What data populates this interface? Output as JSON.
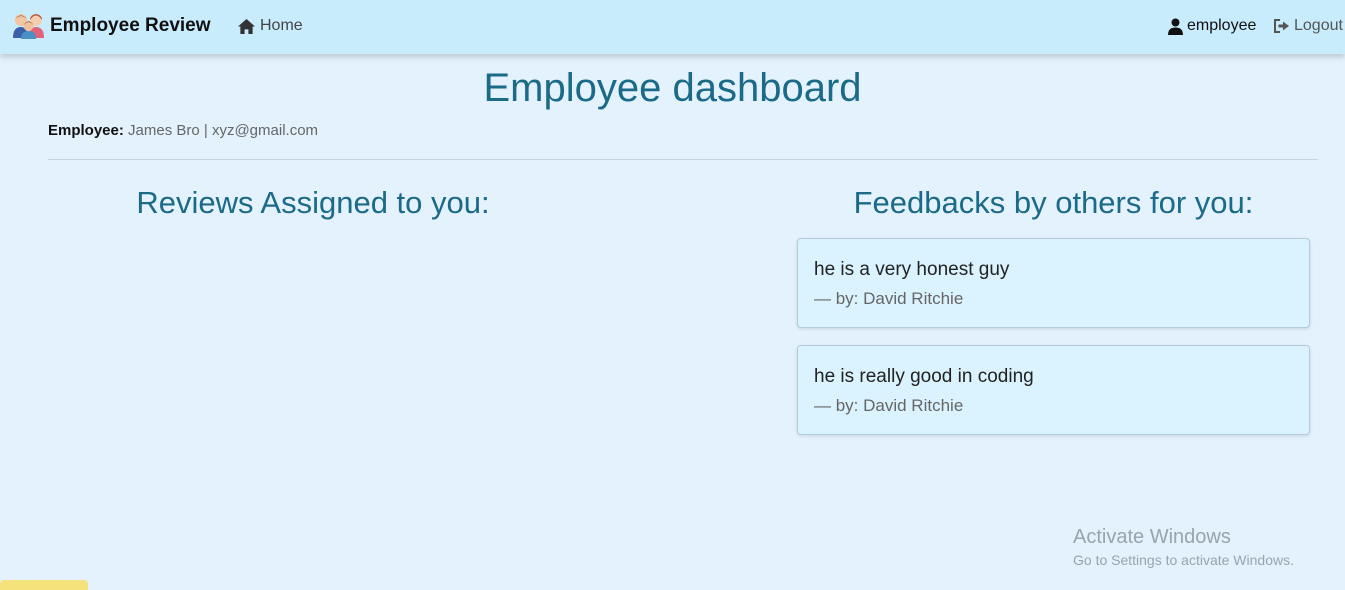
{
  "navbar": {
    "brand": "Employee Review",
    "brand_icon": "team-avatars-icon",
    "home_label": "Home",
    "user_label": "employee",
    "logout_label": "Logout"
  },
  "page": {
    "title": "Employee dashboard",
    "employee_label": "Employee:",
    "employee_value": "James Bro | xyz@gmail.com"
  },
  "reviews": {
    "title": "Reviews Assigned to you:",
    "items": []
  },
  "feedbacks": {
    "title": "Feedbacks by others for you:",
    "items": [
      {
        "text": "he is a very honest guy",
        "author": "— by: David Ritchie"
      },
      {
        "text": "he is really good in coding",
        "author": "— by: David Ritchie"
      }
    ]
  },
  "system_overlay": {
    "title": "Activate Windows",
    "subtitle": "Go to Settings to activate Windows."
  },
  "colors": {
    "page_bg": "#e3f2fd",
    "navbar_bg": "#c9ecfd",
    "heading": "#1b6a87",
    "card_bg": "#dbf3fe"
  }
}
